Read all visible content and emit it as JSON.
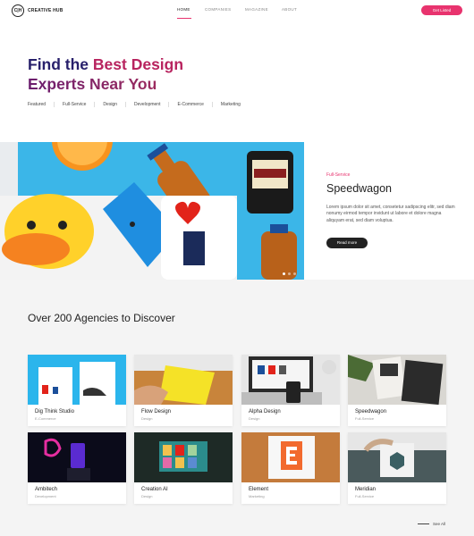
{
  "brand": {
    "mark": "C|H",
    "name": "CREATIVE HUB"
  },
  "nav": {
    "items": [
      {
        "label": "HOME",
        "active": true
      },
      {
        "label": "COMPANIES",
        "active": false
      },
      {
        "label": "MAGAZINE",
        "active": false
      },
      {
        "label": "ABOUT",
        "active": false
      }
    ],
    "cta": "Get Listed"
  },
  "hero": {
    "title_line1a": "Find the ",
    "title_line1b": "Best Design",
    "title_line2": "Experts Near You",
    "categories": [
      "Featured",
      "Full-Service",
      "Design",
      "Development",
      "E-Commerce",
      "Marketing"
    ]
  },
  "feature": {
    "tag": "Full-Service",
    "title": "Speedwagon",
    "body": "Lorem ipsum dolor sit amet, consetetur sadipscing elitr, sed diam nonumy eirmod tempor invidunt ut labore et dolore magna aliquyam erat, sed diam voluptua.",
    "button": "Read more",
    "slides": 3,
    "active_slide": 1
  },
  "agencies": {
    "title": "Over 200 Agencies to Discover",
    "cards": [
      {
        "name": "Dig Think Studio",
        "category": "E-Commerce"
      },
      {
        "name": "Flow Design",
        "category": "Design"
      },
      {
        "name": "Alpha Design",
        "category": "Design"
      },
      {
        "name": "Speedwagon",
        "category": "Full-Service"
      },
      {
        "name": "Ambitech",
        "category": "Development"
      },
      {
        "name": "Creation AI",
        "category": "Design"
      },
      {
        "name": "Element",
        "category": "Marketing"
      },
      {
        "name": "Meridian",
        "category": "Full-Service"
      }
    ],
    "see_all": "See All"
  },
  "colors": {
    "accent": "#e8336e",
    "title_dark": "#28206b",
    "button_dark": "#222222"
  }
}
